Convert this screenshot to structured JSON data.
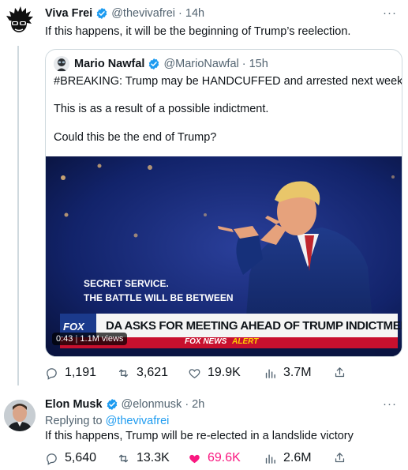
{
  "tweet1": {
    "author_name": "Viva Frei",
    "handle_time": "@thevivafrei · 14h",
    "more": "···",
    "text": "If this happens, it will be the beginning of Trump’s reelection.",
    "quote": {
      "author_name": "Mario Nawfal",
      "handle_time": "@MarioNawfal · 15h",
      "line1": "#BREAKING: Trump may be HANDCUFFED and arrested next week.",
      "line2": "This is as a result of a possible indictment.",
      "line3": "Could this be the end of Trump?",
      "media": {
        "caption_line1": "SECRET SERVICE.",
        "caption_line2": "THE BATTLE WILL BE BETWEEN",
        "network_logo": "FOX",
        "headline": "DA ASKS FOR MEETING AHEAD OF TRUMP INDICTMENT",
        "ticker_network": "FOX NEWS",
        "ticker_alert": "ALERT",
        "duration": "0:43",
        "views": "1.1M views"
      }
    },
    "actions": {
      "replies": "1,191",
      "retweets": "3,621",
      "likes": "19.9K",
      "views": "3.7M"
    }
  },
  "tweet2": {
    "author_name": "Elon Musk",
    "handle_time": "@elonmusk · 2h",
    "more": "···",
    "replying_prefix": "Replying to ",
    "replying_handle": "@thevivafrei",
    "text": "If this happens, Trump will be re-elected in a landslide victory",
    "actions": {
      "replies": "5,640",
      "retweets": "13.3K",
      "likes": "69.6K",
      "views": "2.6M"
    }
  },
  "colors": {
    "verified": "#1d9bf0",
    "muted": "#536471",
    "liked": "#f91880",
    "link": "#1d9bf0"
  }
}
